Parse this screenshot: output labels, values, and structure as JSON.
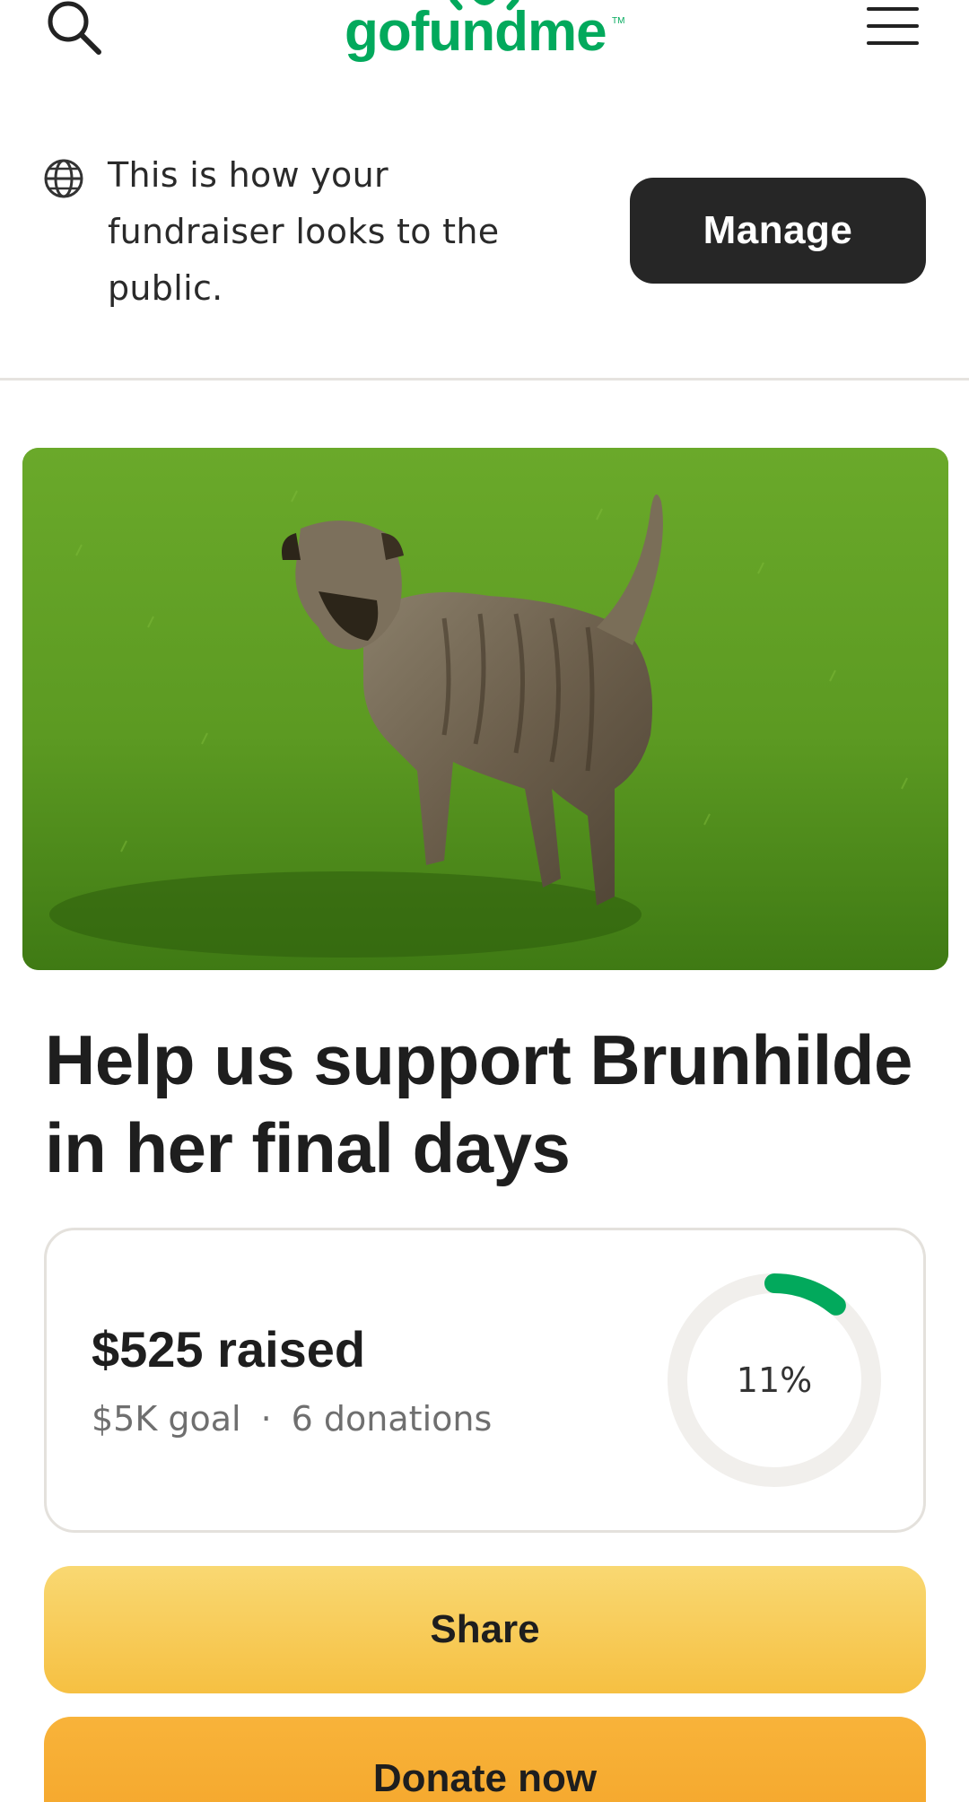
{
  "header": {
    "logo_text": "gofundme",
    "logo_tm": "TM",
    "search_icon": "search-icon",
    "menu_icon": "hamburger-menu-icon"
  },
  "notice": {
    "icon": "globe-icon",
    "text": "This is how your fundraiser looks to the public.",
    "manage_label": "Manage"
  },
  "campaign": {
    "image": "dog-on-grass-photo",
    "title": "Help us support Brunhilde in her final days"
  },
  "progress": {
    "raised": "$525 raised",
    "goal": "$5K goal",
    "separator": "·",
    "donations": "6 donations",
    "percent_label": "11%",
    "percent_value": 0.11
  },
  "actions": {
    "share_label": "Share",
    "donate_label": "Donate now"
  },
  "colors": {
    "brand_green": "#02a95c",
    "manage_bg": "#262626",
    "share_bg": "#f8cd5a",
    "donate_bg": "#f6ab32",
    "ring_track": "#f1efec"
  }
}
